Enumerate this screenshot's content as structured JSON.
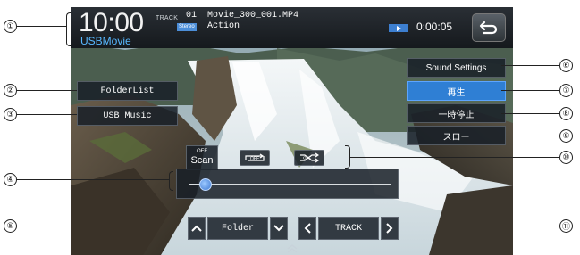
{
  "header": {
    "clock": "10:00",
    "source": "USBMovie",
    "track_label": "TRACK",
    "track_number": "01",
    "file_name": "Movie_300_001.MP4",
    "stereo_badge": "Stereo",
    "genre": "Action",
    "elapsed_time": "0:00:05",
    "play_state_icon": "play-icon",
    "back_icon": "back-return-icon"
  },
  "left_buttons": {
    "folder_list": "FolderList",
    "usb_music": "USB Music"
  },
  "right_buttons": {
    "sound_settings": "Sound Settings",
    "play": "再生",
    "pause": "一時停止",
    "slow": "スロー"
  },
  "mode_buttons": {
    "scan_state": "OFF",
    "scan_label": "Scan",
    "repeat_state": "OFF",
    "repeat_icon": "repeat-icon",
    "shuffle_icon": "shuffle-icon"
  },
  "playback": {
    "progress_fraction": 0.05
  },
  "bottom_controls": {
    "folder_label": "Folder",
    "track_label": "TRACK",
    "folder_up_icon": "chevron-up-icon",
    "folder_down_icon": "chevron-down-icon",
    "track_prev_icon": "chevron-left-icon",
    "track_next_icon": "chevron-right-icon",
    "more_icon": "double-chevron-up-icon"
  },
  "callouts": [
    "①",
    "②",
    "③",
    "④",
    "⑤",
    "⑥",
    "⑦",
    "⑧",
    "⑨",
    "⑩",
    "⑪"
  ],
  "colors": {
    "accent_blue": "#2f7fd4",
    "source_text": "#58b8ff",
    "header_bg": "#15191d"
  }
}
